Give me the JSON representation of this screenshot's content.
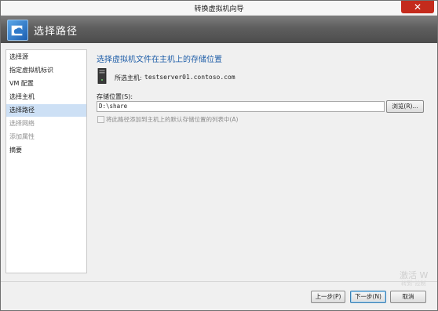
{
  "window": {
    "title": "转换虚拟机向导",
    "close_glyph": "✕"
  },
  "header": {
    "title": "选择路径",
    "icon": "cloud-page-icon"
  },
  "nav": {
    "items": [
      {
        "label": "选择源",
        "state": "normal"
      },
      {
        "label": "指定虚拟机标识",
        "state": "normal"
      },
      {
        "label": "VM 配置",
        "state": "normal"
      },
      {
        "label": "选择主机",
        "state": "normal"
      },
      {
        "label": "选择路径",
        "state": "active"
      },
      {
        "label": "选择网络",
        "state": "disabled"
      },
      {
        "label": "添加属性",
        "state": "disabled"
      },
      {
        "label": "摘要",
        "state": "normal"
      }
    ]
  },
  "content": {
    "title": "选择虚拟机文件在主机上的存储位置",
    "host_label": "所选主机:",
    "host_value": "testserver01.contoso.com",
    "location_label": "存储位置(S):",
    "location_value": "D:\\share",
    "browse_label": "浏览(R)...",
    "checkbox_label": "将此路径添加到主机上的默认存储位置的列表中(A)",
    "checkbox_checked": false
  },
  "watermark": {
    "line1": "激活 W",
    "line2": "转到“控制"
  },
  "footer": {
    "prev_label": "上一步(P)",
    "next_label": "下一步(N)",
    "cancel_label": "取消"
  },
  "colors": {
    "accent": "#1f5ea8",
    "header_bg": "#5e5e5e",
    "nav_active": "#cde0f5",
    "close_button": "#c42b1c"
  }
}
